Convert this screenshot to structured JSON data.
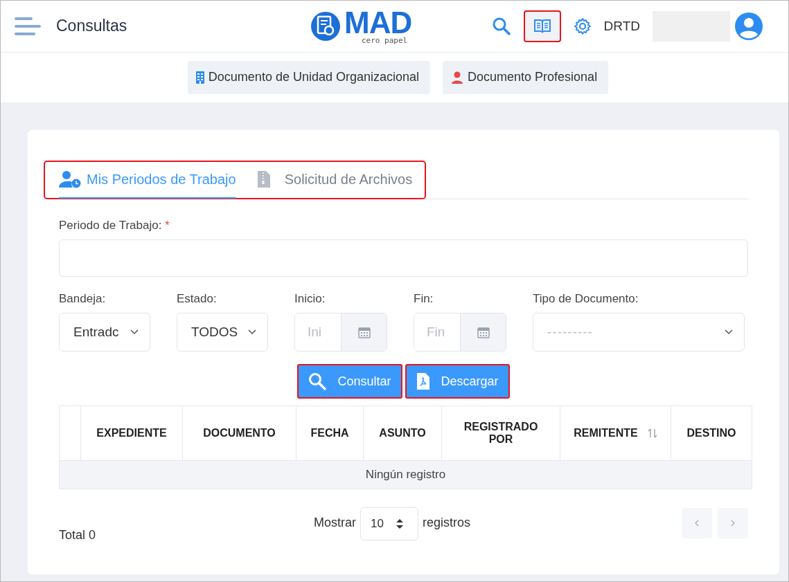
{
  "header": {
    "title": "Consultas",
    "logo": {
      "name": "MAD",
      "tagline": "cero papel"
    },
    "user": "DRTD",
    "book_highlighted": true
  },
  "subnav": [
    {
      "label": "Documento de Unidad Organizacional",
      "kind": "unit"
    },
    {
      "label": "Documento Profesional",
      "kind": "person"
    }
  ],
  "tabs": {
    "highlighted": true,
    "items": [
      {
        "label": "Mis Periodos de Trabajo",
        "selected": true,
        "kind": "user-clock"
      },
      {
        "label": "Solicitud de Archivos",
        "selected": false,
        "kind": "zip"
      }
    ]
  },
  "period": {
    "label": "Periodo de Trabajo:",
    "required_mark": "*"
  },
  "filters": [
    {
      "label": "Bandeja:",
      "kind": "select",
      "value": "Entradc"
    },
    {
      "label": "Estado:",
      "kind": "select",
      "value": "TODOS"
    },
    {
      "label": "Inicio:",
      "kind": "date",
      "placeholder": "Ini"
    },
    {
      "label": "Fin:",
      "kind": "date",
      "placeholder": "Fin"
    },
    {
      "label": "Tipo de Documento:",
      "kind": "select",
      "value": "---------"
    }
  ],
  "buttons": [
    {
      "label": "Consultar",
      "kind": "search",
      "highlighted": true
    },
    {
      "label": "Descargar",
      "kind": "pdf",
      "highlighted": true
    }
  ],
  "table": {
    "columns": [
      {
        "label": "EXPEDIENTE",
        "sortable": false
      },
      {
        "label": "DOCUMENTO",
        "sortable": false
      },
      {
        "label": "FECHA",
        "sortable": false
      },
      {
        "label": "ASUNTO",
        "sortable": false
      },
      {
        "label": "REGISTRADO POR",
        "sortable": false
      },
      {
        "label": "REMITENTE",
        "sortable": true
      },
      {
        "label": "DESTINO",
        "sortable": false
      }
    ],
    "empty": "Ningún registro"
  },
  "footer": {
    "total": "Total 0",
    "show": "Mostrar",
    "page_size": "10",
    "records": "registros"
  }
}
